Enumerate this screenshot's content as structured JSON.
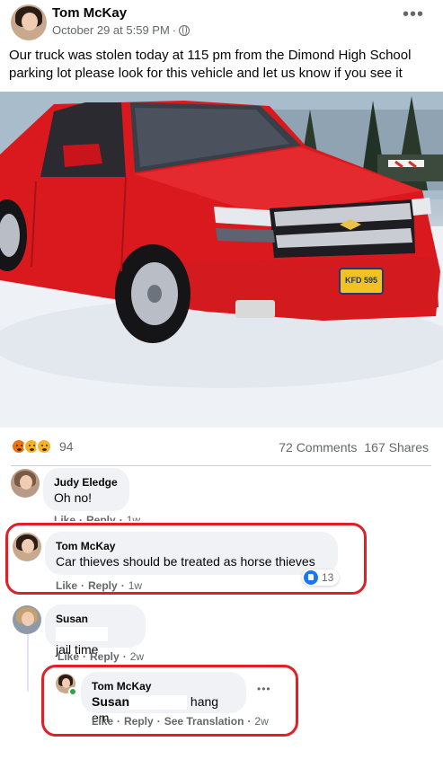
{
  "post": {
    "author": "Tom McKay",
    "timestamp": "October 29 at 5:59 PM",
    "privacy_icon": "globe-icon",
    "more_label": "•••",
    "text": "Our truck was stolen today at 115 pm from the Dimond High School parking lot please look for this vehicle and let us know if you see it",
    "license_plate": "KFD 595"
  },
  "stats": {
    "reaction_icons": [
      "angry-icon",
      "wow-icon",
      "sad-icon"
    ],
    "reaction_count": "94",
    "comments_label": "72 Comments",
    "shares_label": "167 Shares"
  },
  "comments": [
    {
      "name": "Judy Eledge",
      "text": "Oh no!",
      "actions": [
        "Like",
        "Reply"
      ],
      "time": "1w"
    },
    {
      "name": "Tom McKay",
      "text": "Car thieves should be treated as horse thieves",
      "actions": [
        "Like",
        "Reply"
      ],
      "time": "1w",
      "like_count": "13"
    },
    {
      "name": "Susan",
      "text": "jail time",
      "actions": [
        "Like",
        "Reply"
      ],
      "time": "2w"
    },
    {
      "name": "Tom McKay",
      "mention": "Susan",
      "text": "hang em",
      "actions": [
        "Like",
        "Reply",
        "See Translation"
      ],
      "time": "2w",
      "more_label": "•••"
    }
  ],
  "colors": {
    "highlight": "#e01f26",
    "truck": "#d9191e",
    "link_blue": "#1877f2",
    "muted_text": "#65676b"
  }
}
